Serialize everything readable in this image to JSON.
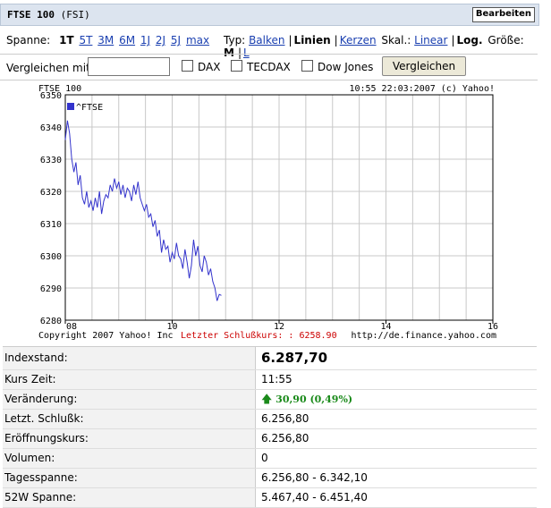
{
  "header": {
    "title": "FTSE 100",
    "subtitle": "(FSI)",
    "edit_label": "Bearbeiten"
  },
  "toolbar": {
    "span_label": "Spanne:",
    "spans": [
      "1T",
      "5T",
      "3M",
      "6M",
      "1J",
      "2J",
      "5J",
      "max"
    ],
    "active_span": "1T",
    "type_label": "Typ:",
    "types": [
      "Balken",
      "Linien",
      "Kerzen"
    ],
    "active_type": "Linien",
    "scale_label": "Skal.:",
    "scales": [
      "Linear",
      "Log."
    ],
    "active_scale": "Log.",
    "size_label": "Größe:",
    "sizes": [
      "M",
      "L"
    ],
    "active_size": "M"
  },
  "compare": {
    "label": "Vergleichen mit:",
    "input_value": "",
    "checkboxes": [
      {
        "label": "DAX",
        "checked": false
      },
      {
        "label": "TECDAX",
        "checked": false
      },
      {
        "label": "Dow Jones",
        "checked": false
      }
    ],
    "button_label": "Vergleichen"
  },
  "chart_data": {
    "type": "line",
    "title": "FTSE 100",
    "timestamp": "10:55 22:03:2007 (c) Yahoo!",
    "legend": "^FTSE",
    "legend_position": "top-left",
    "ylim": [
      6280,
      6350
    ],
    "yticks": [
      6280,
      6290,
      6300,
      6310,
      6320,
      6330,
      6340,
      6350
    ],
    "xlim": [
      8,
      16
    ],
    "xticks": [
      {
        "value": 8,
        "label": "08"
      },
      {
        "value": 10,
        "label": "10"
      },
      {
        "value": 12,
        "label": "12"
      },
      {
        "value": 14,
        "label": "14"
      },
      {
        "value": 16,
        "label": "16"
      }
    ],
    "grid": true,
    "series_color": "#3333cc",
    "series": [
      {
        "name": "^FTSE",
        "x": [
          8.0,
          8.04,
          8.08,
          8.12,
          8.16,
          8.2,
          8.24,
          8.28,
          8.32,
          8.36,
          8.4,
          8.44,
          8.48,
          8.52,
          8.56,
          8.6,
          8.64,
          8.68,
          8.72,
          8.76,
          8.8,
          8.84,
          8.88,
          8.92,
          8.96,
          9.0,
          9.04,
          9.08,
          9.12,
          9.16,
          9.2,
          9.24,
          9.28,
          9.32,
          9.36,
          9.4,
          9.44,
          9.48,
          9.52,
          9.56,
          9.6,
          9.64,
          9.68,
          9.72,
          9.76,
          9.8,
          9.84,
          9.88,
          9.92,
          9.96,
          10.0,
          10.04,
          10.08,
          10.12,
          10.16,
          10.2,
          10.24,
          10.28,
          10.32,
          10.36,
          10.4,
          10.44,
          10.48,
          10.52,
          10.56,
          10.6,
          10.64,
          10.68,
          10.72,
          10.76,
          10.8,
          10.84,
          10.88,
          10.92
        ],
        "values": [
          6336,
          6342,
          6338,
          6330,
          6326,
          6329,
          6322,
          6325,
          6318,
          6316,
          6320,
          6315,
          6317,
          6314,
          6318,
          6315,
          6320,
          6313,
          6317,
          6319,
          6318,
          6322,
          6320,
          6324,
          6321,
          6323,
          6319,
          6322,
          6318,
          6321,
          6320,
          6317,
          6322,
          6319,
          6323,
          6318,
          6316,
          6314,
          6316,
          6312,
          6313,
          6309,
          6311,
          6306,
          6308,
          6301,
          6305,
          6302,
          6303,
          6298,
          6301,
          6299,
          6304,
          6300,
          6299,
          6296,
          6302,
          6298,
          6293,
          6297,
          6305,
          6300,
          6303,
          6297,
          6295,
          6300,
          6298,
          6294,
          6296,
          6292,
          6290,
          6286,
          6288,
          6287.7
        ]
      }
    ],
    "copyright": "Copyright 2007 Yahoo! Inc",
    "last_close_label": "Letzter Schlußkurs: : 6258.90",
    "source_url": "http://de.finance.yahoo.com"
  },
  "quote_table": [
    {
      "label": "Indexstand:",
      "value": "6.287,70"
    },
    {
      "label": "Kurs Zeit:",
      "value": "11:55"
    },
    {
      "label": "Veränderung:",
      "value": "30,90 (0,49%)"
    },
    {
      "label": "Letzt. Schlußk:",
      "value": "6.256,80"
    },
    {
      "label": "Eröffnungskurs:",
      "value": "6.256,80"
    },
    {
      "label": "Volumen:",
      "value": "0"
    },
    {
      "label": "Tagesspanne:",
      "value": "6.256,80 - 6.342,10"
    },
    {
      "label": "52W Spanne:",
      "value": "5.467,40 - 6.451,40"
    }
  ]
}
